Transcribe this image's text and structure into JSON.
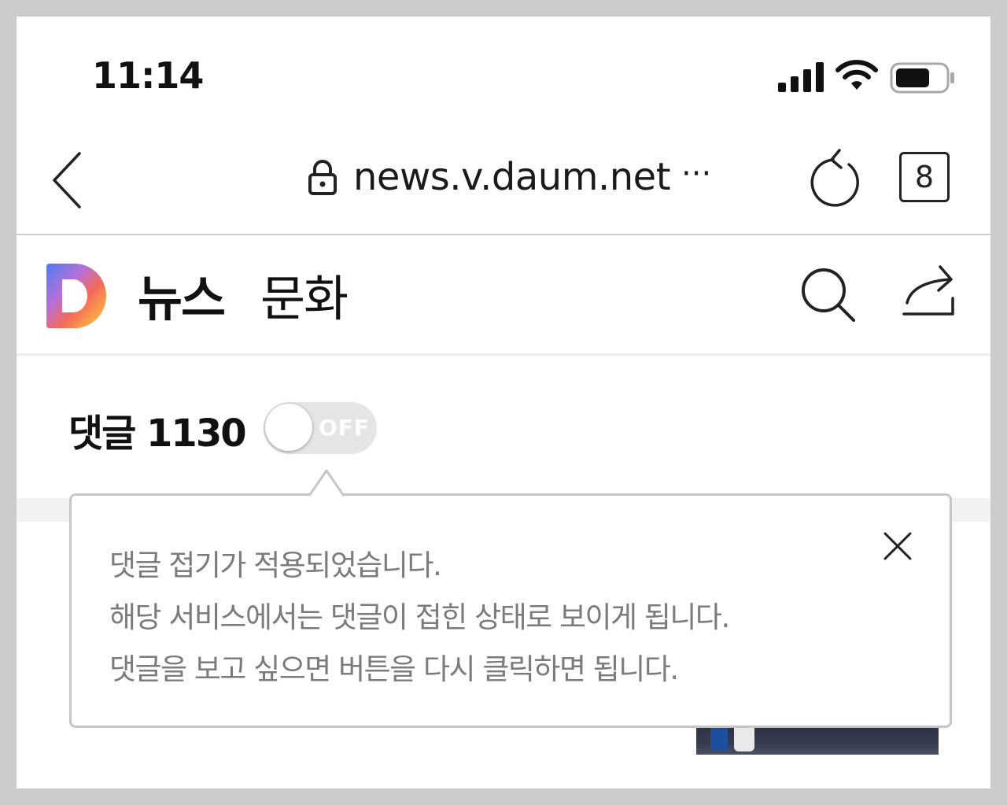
{
  "status_bar": {
    "time": "11:14",
    "icons": [
      "cellular-signal-icon",
      "wifi-icon",
      "battery-icon"
    ]
  },
  "browser": {
    "url": "news.v.daum.net",
    "more": "···",
    "tab_count": "8",
    "icons": [
      "back-chevron-icon",
      "lock-icon",
      "reload-icon"
    ]
  },
  "header": {
    "logo": "D",
    "section": "뉴스",
    "category": "문화",
    "icons": [
      "search-icon",
      "share-icon"
    ]
  },
  "comments": {
    "label": "댓글 1130",
    "toggle_label": "OFF",
    "toggle_on": false
  },
  "tooltip": {
    "lines": [
      "댓글 접기가 적용되었습니다.",
      "해당 서비스에서는 댓글이 접힌 상태로 보이게 됩니다.",
      "댓글을 보고 싶으면 버튼을 다시 클릭하면 됩니다."
    ],
    "close_icon": "close-icon"
  },
  "colors": {
    "background": "#cccccc",
    "text": "#111111",
    "tooltip_text": "#7b7b7b",
    "toggle_off": "#e5e5e5"
  }
}
